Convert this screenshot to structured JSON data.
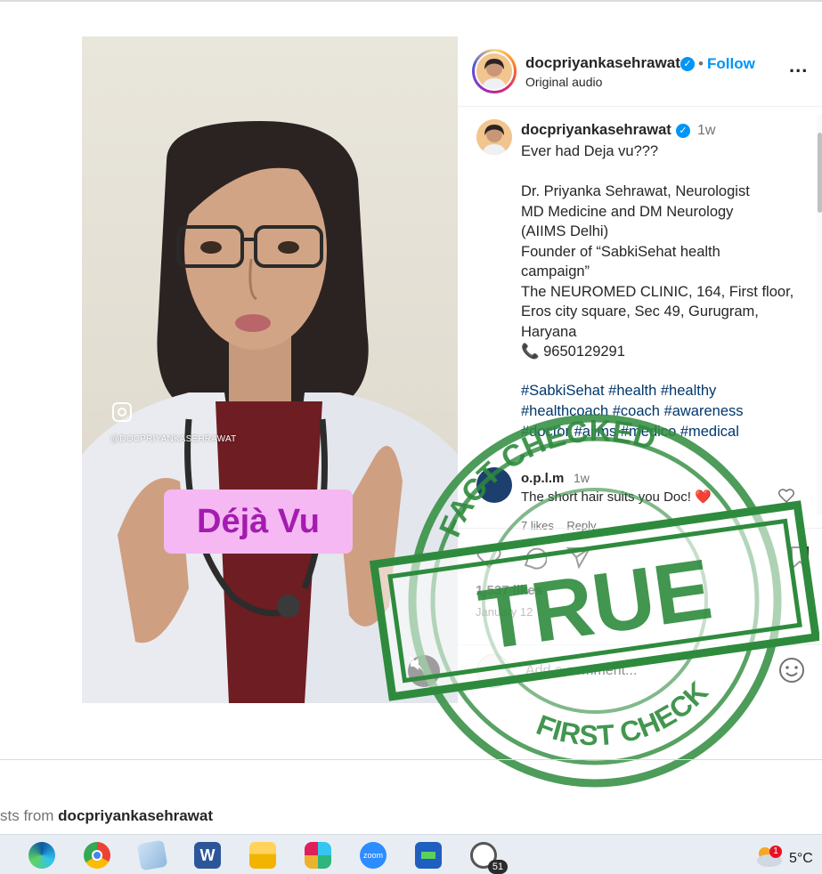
{
  "video": {
    "watermark_handle": "@DOCPRIYANKASEHRAWAT",
    "caption_text": "Déjà Vu",
    "mute_icon": "speaker-muted-icon"
  },
  "header": {
    "username": "docpriyankasehrawat",
    "separator": "•",
    "follow_label": "Follow",
    "audio_label": "Original audio",
    "more_label": "..."
  },
  "post": {
    "username": "docpriyankasehrawat",
    "time": "1w",
    "caption": "Ever had Deja vu???\n\nDr. Priyanka Sehrawat, Neurologist\nMD Medicine and DM Neurology\n(AIIMS Delhi)\nFounder of “SabkiSehat health\ncampaign”\nThe NEUROMED CLINIC, 164, First floor,\nEros city square, Sec 49, Gurugram,\nHaryana\n📞 9650129291",
    "hashtags": "#SabkiSehat #health #healthy\n#healthcoach #coach #awareness\n#doctor #aiims #medico #medical"
  },
  "comment": {
    "username": "o.p.l.m",
    "time": "1w",
    "text": "The short hair suits you Doc! ❤️",
    "likes": "7 likes",
    "reply_label": "Reply"
  },
  "stats": {
    "likes": "1,537 likes",
    "date": "January 12"
  },
  "add_comment": {
    "placeholder": "Add a comment..."
  },
  "stamp": {
    "top_text": "FACT CHECKED",
    "verdict": "TRUE",
    "bottom_text": "FIRST CHECK",
    "color": "#2e8b3d"
  },
  "more_posts": {
    "prefix": "sts from ",
    "username": "docpriyankasehrawat"
  },
  "taskbar": {
    "apps": [
      "edge-icon",
      "chrome-icon",
      "notepad-icon",
      "word-icon",
      "file-explorer-icon",
      "slack-icon",
      "zoom-icon",
      "app-icon",
      "whatsapp-icon"
    ],
    "zoom_label": "zoom",
    "whatsapp_badge": "51",
    "weather_badge": "1",
    "temperature": "5°C"
  },
  "colors": {
    "accent": "#0095f6",
    "hashtag": "#00376b",
    "caption_bg": "#f5b8f2",
    "caption_text": "#a41bb0"
  }
}
